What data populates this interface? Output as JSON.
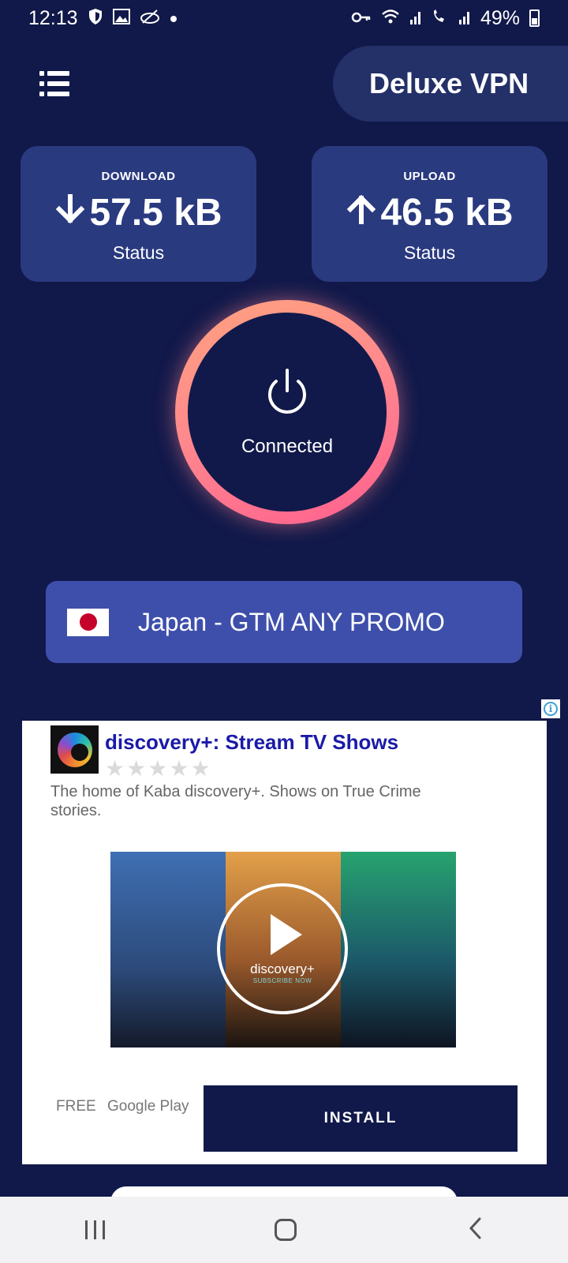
{
  "status_bar": {
    "time": "12:13",
    "battery": "49%",
    "icons_left": [
      "shield-icon",
      "image-icon",
      "game-icon",
      "dot-icon"
    ],
    "icons_right": [
      "key-icon",
      "wifi-icon",
      "signal-icon",
      "call-signal-icon",
      "signal-icon",
      "battery-icon"
    ]
  },
  "header": {
    "app_title": "Deluxe VPN",
    "menu_icon": "list-menu-icon"
  },
  "stats": {
    "download": {
      "label": "DOWNLOAD",
      "value": "57.5 kB",
      "status": "Status",
      "icon": "arrow-down-icon"
    },
    "upload": {
      "label": "UPLOAD",
      "value": "46.5 kB",
      "status": "Status",
      "icon": "arrow-up-icon"
    }
  },
  "connection": {
    "state": "Connected",
    "icon": "power-icon",
    "ring_colors": [
      "#ffa27f",
      "#ff5f8f"
    ]
  },
  "server": {
    "label": "Japan - GTM ANY PROMO",
    "flag": "japan-flag-icon"
  },
  "ad": {
    "title": "discovery+: Stream TV Shows",
    "rating_stars": 5,
    "description": "The home of Kaba discovery+. Shows on True Crime stories.",
    "video_brand": "discovery+",
    "video_subtitle": "SUBSCRIBE NOW",
    "price": "FREE",
    "store": "Google Play",
    "install_label": "INSTALL"
  },
  "colors": {
    "background": "#11194a",
    "card": "#2a3a7f",
    "server_button": "#3e4fab",
    "ad_title": "#1a1aa8"
  }
}
